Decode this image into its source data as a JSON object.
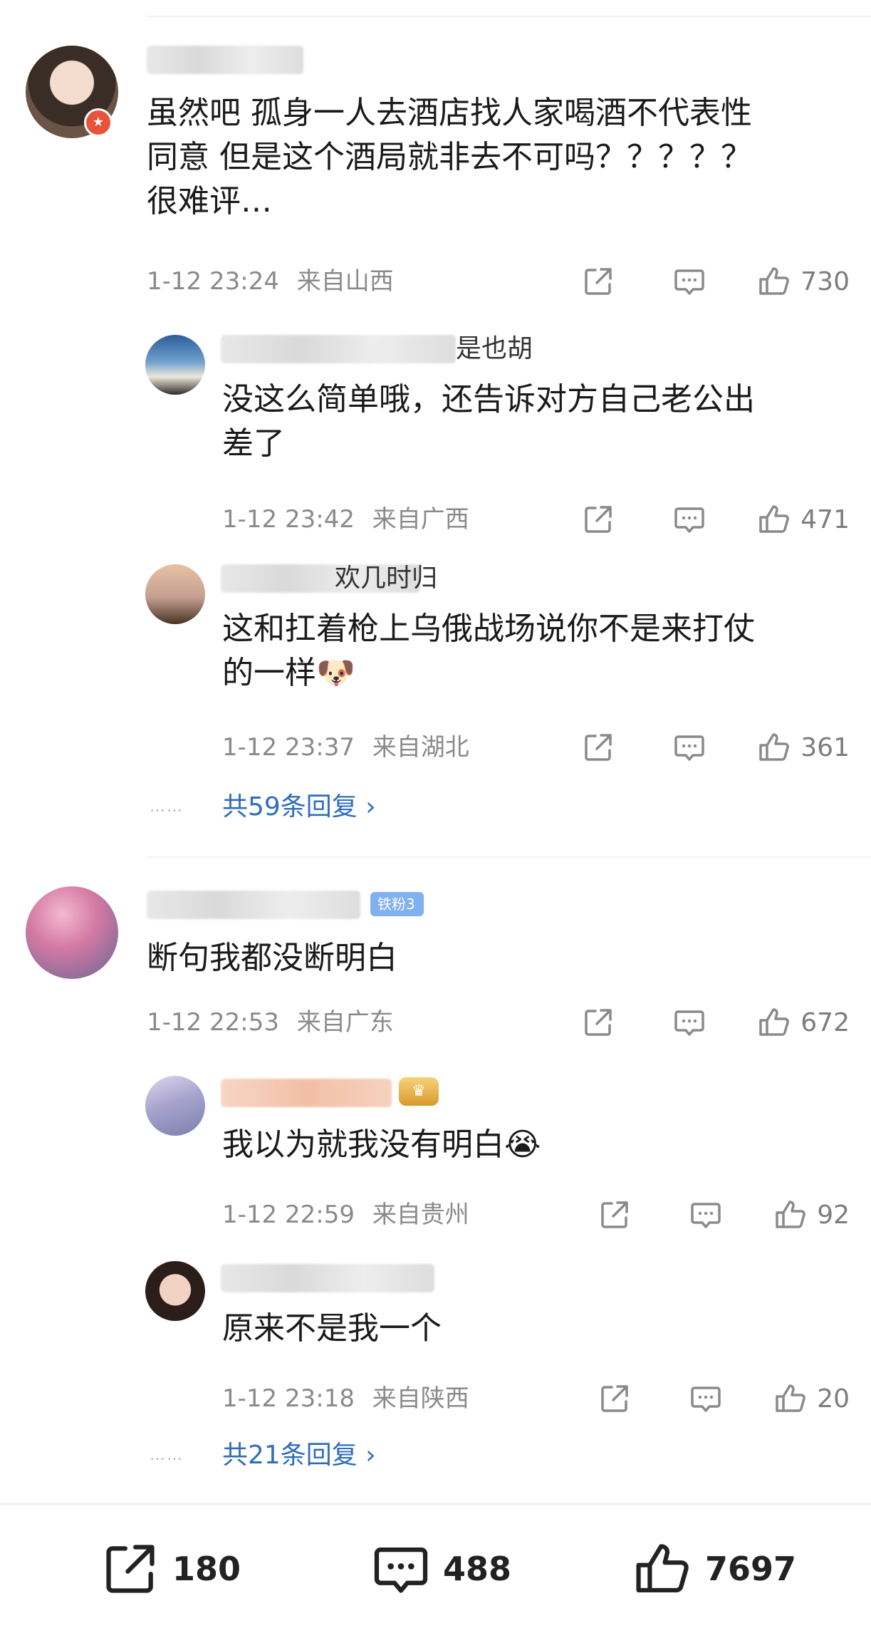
{
  "comments": [
    {
      "text": "虽然吧 孤身一人去酒店找人家喝酒不代表性\n同意 但是这个酒局就非去不可吗？？？？？\n很难评…",
      "time": "1-12 23:24",
      "location": "来自山西",
      "likes": "730",
      "replies": [
        {
          "name_suffix": "是也胡",
          "text": "没这么简单哦，还告诉对方自己老公出\n差了",
          "time": "1-12 23:42",
          "location": "来自广西",
          "likes": "471"
        },
        {
          "name_suffix": "欢几时归",
          "text": "这和扛着枪上乌俄战场说你不是来打仗\n的一样🐶",
          "time": "1-12 23:37",
          "location": "来自湖北",
          "likes": "361"
        }
      ],
      "more_dots": "……",
      "more_label": "共59条回复 ›"
    },
    {
      "badge": "铁粉3",
      "text": "断句我都没断明白",
      "time": "1-12 22:53",
      "location": "来自广东",
      "likes": "672",
      "replies": [
        {
          "text": "我以为就我没有明白😭",
          "time": "1-12 22:59",
          "location": "来自贵州",
          "likes": "92"
        },
        {
          "text": "原来不是我一个",
          "time": "1-12 23:18",
          "location": "来自陕西",
          "likes": "20"
        }
      ],
      "more_dots": "……",
      "more_label": "共21条回复 ›"
    }
  ],
  "bottom_bar": {
    "shares": "180",
    "comments": "488",
    "likes": "7697"
  },
  "icons": {
    "share": "share-icon",
    "comment": "comment-icon",
    "like": "like-icon"
  },
  "colors": {
    "link": "#2f6dbb",
    "meta": "#8a8a8a",
    "fan_badge": "#7fb0ef"
  }
}
